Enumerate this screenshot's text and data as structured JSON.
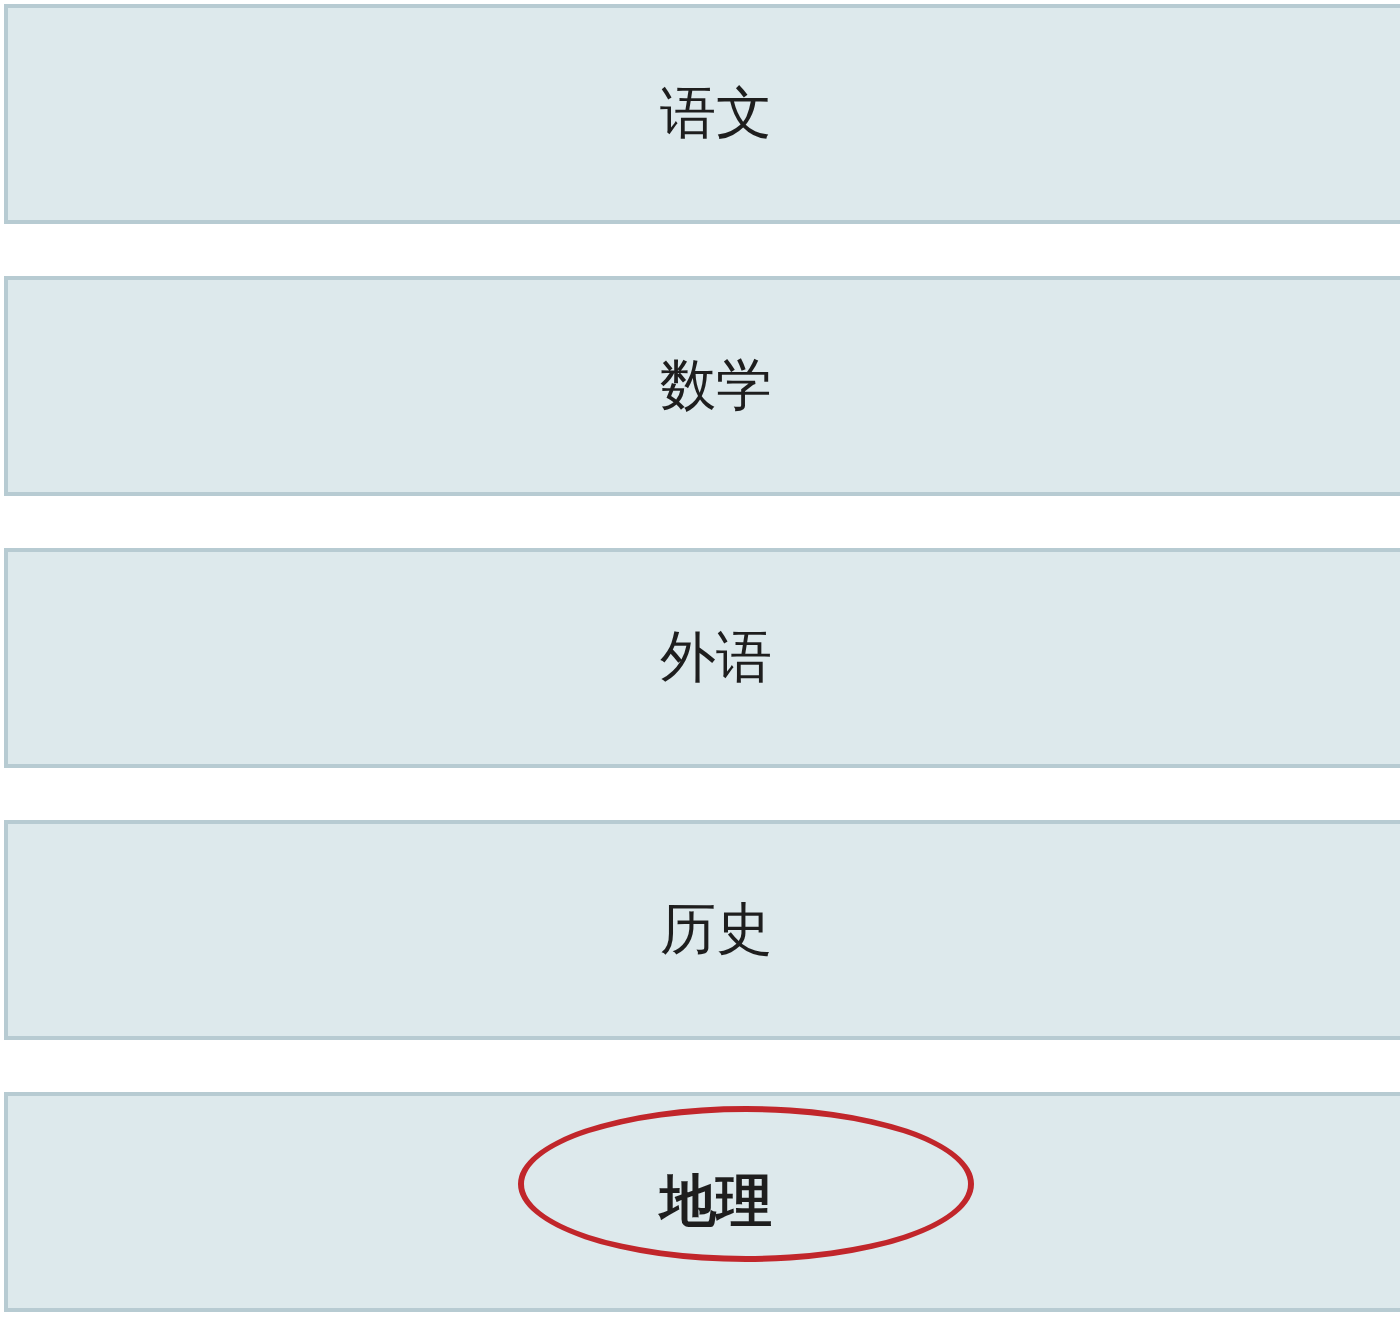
{
  "subjects": [
    {
      "label": "语文",
      "circled": false
    },
    {
      "label": "数学",
      "circled": false
    },
    {
      "label": "外语",
      "circled": false
    },
    {
      "label": "历史",
      "circled": false
    },
    {
      "label": "地理",
      "circled": true
    }
  ]
}
